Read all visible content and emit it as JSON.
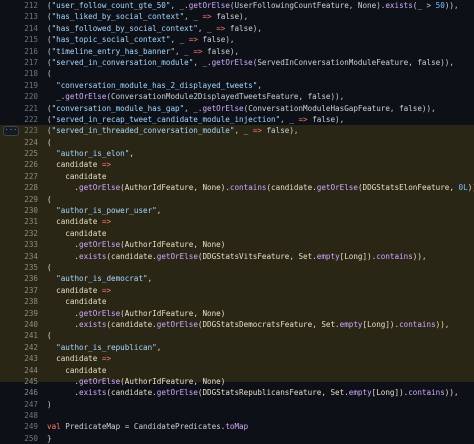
{
  "more_button_label": "···",
  "lines": [
    {
      "n": "212",
      "t": "(\"user_follow_count_gte_50\", _.getOrElse(UserFollowingCountFeature, None).exists(_ > 50)),",
      "hl": false
    },
    {
      "n": "213",
      "t": "(\"has_liked_by_social_context\", _ => false),",
      "hl": false
    },
    {
      "n": "214",
      "t": "(\"has_followed_by_social_context\", _ => false),",
      "hl": false
    },
    {
      "n": "215",
      "t": "(\"has_topic_social_context\", _ => false),",
      "hl": false
    },
    {
      "n": "216",
      "t": "(\"timeline_entry_has_banner\", _ => false),",
      "hl": false
    },
    {
      "n": "217",
      "t": "(\"served_in_conversation_module\", _.getOrElse(ServedInConversationModuleFeature, false)),",
      "hl": false
    },
    {
      "n": "218",
      "t": "(",
      "hl": false
    },
    {
      "n": "219",
      "t": "  \"conversation_module_has_2_displayed_tweets\",",
      "hl": false
    },
    {
      "n": "220",
      "t": "  _.getOrElse(ConversationModule2DisplayedTweetsFeature, false)),",
      "hl": false
    },
    {
      "n": "221",
      "t": "(\"conversation_module_has_gap\", _.getOrElse(ConversationModuleHasGapFeature, false)),",
      "hl": false
    },
    {
      "n": "222",
      "t": "(\"served_in_recap_tweet_candidate_module_injection\", _ => false),",
      "hl": false
    },
    {
      "n": "223",
      "t": "(\"served_in_threaded_conversation_module\", _ => false),",
      "hl": false
    },
    {
      "n": "224",
      "t": "(",
      "hl": true
    },
    {
      "n": "225",
      "t": "  \"author_is_elon\",",
      "hl": true
    },
    {
      "n": "226",
      "t": "  candidate =>",
      "hl": true
    },
    {
      "n": "227",
      "t": "    candidate",
      "hl": true
    },
    {
      "n": "228",
      "t": "      .getOrElse(AuthorIdFeature, None).contains(candidate.getOrElse(DDGStatsElonFeature, 0L))),",
      "hl": true
    },
    {
      "n": "229",
      "t": "(",
      "hl": true
    },
    {
      "n": "230",
      "t": "  \"author_is_power_user\",",
      "hl": true
    },
    {
      "n": "231",
      "t": "  candidate =>",
      "hl": true
    },
    {
      "n": "232",
      "t": "    candidate",
      "hl": true
    },
    {
      "n": "233",
      "t": "      .getOrElse(AuthorIdFeature, None)",
      "hl": true
    },
    {
      "n": "234",
      "t": "      .exists(candidate.getOrElse(DDGStatsVitsFeature, Set.empty[Long]).contains)),",
      "hl": true
    },
    {
      "n": "235",
      "t": "(",
      "hl": true
    },
    {
      "n": "236",
      "t": "  \"author_is_democrat\",",
      "hl": true
    },
    {
      "n": "237",
      "t": "  candidate =>",
      "hl": true
    },
    {
      "n": "238",
      "t": "    candidate",
      "hl": true
    },
    {
      "n": "239",
      "t": "      .getOrElse(AuthorIdFeature, None)",
      "hl": true
    },
    {
      "n": "240",
      "t": "      .exists(candidate.getOrElse(DDGStatsDemocratsFeature, Set.empty[Long]).contains)),",
      "hl": true
    },
    {
      "n": "241",
      "t": "(",
      "hl": true
    },
    {
      "n": "242",
      "t": "  \"author_is_republican\",",
      "hl": true
    },
    {
      "n": "243",
      "t": "  candidate =>",
      "hl": true
    },
    {
      "n": "244",
      "t": "    candidate",
      "hl": true
    },
    {
      "n": "245",
      "t": "      .getOrElse(AuthorIdFeature, None)",
      "hl": true
    },
    {
      "n": "246",
      "t": "      .exists(candidate.getOrElse(DDGStatsRepublicansFeature, Set.empty[Long]).contains)),",
      "hl": true
    },
    {
      "n": "247",
      "t": ")",
      "hl": false
    },
    {
      "n": "248",
      "t": "",
      "hl": false
    },
    {
      "n": "249",
      "t": "val PredicateMap = CandidatePredicates.toMap",
      "hl": false
    },
    {
      "n": "250",
      "t": "}",
      "hl": false
    }
  ]
}
